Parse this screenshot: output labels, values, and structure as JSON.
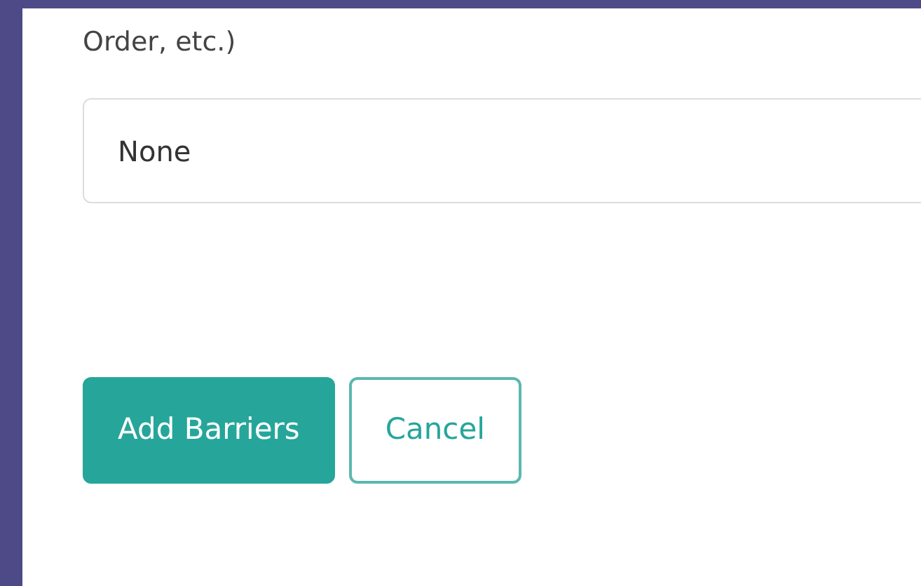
{
  "field": {
    "label": "Order, etc.)",
    "value": "None"
  },
  "buttons": [
    {
      "label": "Add Barriers",
      "kind": "primary"
    },
    {
      "label": "Cancel",
      "kind": "outline"
    }
  ]
}
